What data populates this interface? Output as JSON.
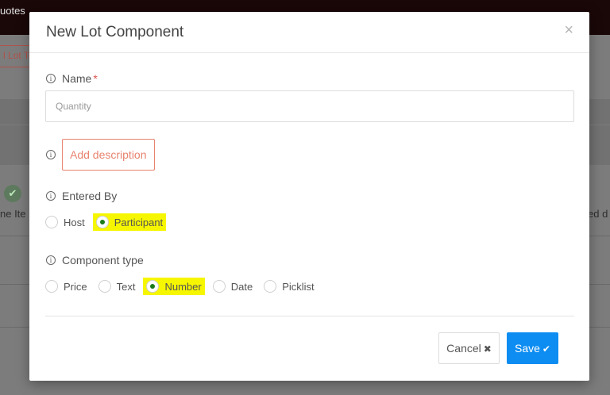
{
  "background": {
    "topbar_title": "uotes",
    "tag_label": "l Lot Te",
    "left_row_text": "ne Ite",
    "right_row_text": "ed d"
  },
  "modal": {
    "title": "New Lot Component",
    "close_symbol": "×",
    "name": {
      "label": "Name",
      "required_mark": "*",
      "placeholder": "Quantity",
      "value": ""
    },
    "description": {
      "button_label": "Add description"
    },
    "entered_by": {
      "label": "Entered By",
      "options": [
        "Host",
        "Participant"
      ],
      "selected": "Participant"
    },
    "component_type": {
      "label": "Component type",
      "options": [
        "Price",
        "Text",
        "Number",
        "Date",
        "Picklist"
      ],
      "selected": "Number"
    },
    "footer": {
      "cancel_label": "Cancel",
      "save_label": "Save"
    }
  },
  "icons": {
    "info": "info-circle-icon",
    "close": "close-icon",
    "cancel": "times-icon",
    "save": "check-icon"
  },
  "colors": {
    "accent_orange": "#e8836f",
    "save_blue": "#0d8df2",
    "highlight_yellow": "#f6f600",
    "radio_selected": "#1a7a1a"
  }
}
